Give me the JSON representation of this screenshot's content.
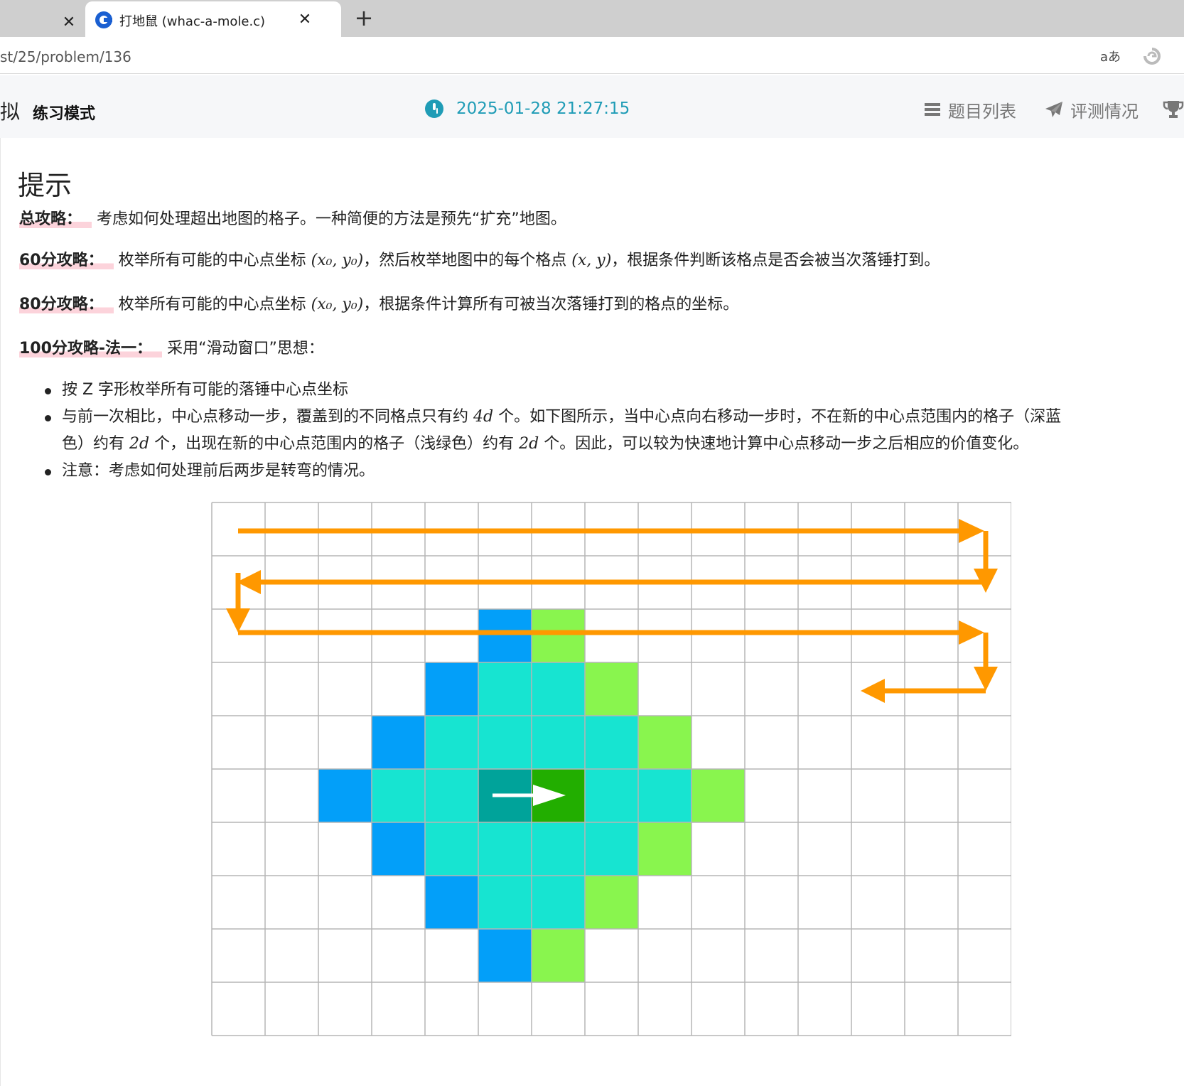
{
  "browser": {
    "active_tab_title": "打地鼠 (whac-a-mole.c)",
    "url": "st/25/problem/136",
    "read_aloud_label": "aあ"
  },
  "header": {
    "site_fragment": "拟",
    "mode": "练习模式",
    "time": "2025-01-28 21:27:15",
    "nav": {
      "problems": "题目列表",
      "status": "评测情况"
    }
  },
  "hint": {
    "title": "提示",
    "p1": {
      "label": "总攻略：",
      "text": "考虑如何处理超出地图的格子。一种简便的方法是预先“扩充”地图。"
    },
    "p2": {
      "label": "60分攻略：",
      "t1": "枚举所有可能的中心点坐标",
      "m1": "(x₀, y₀)",
      "t2": "，然后枚举地图中的每个格点",
      "m2": "(x, y)",
      "t3": "，根据条件判断该格点是否会被当次落锤打到。"
    },
    "p3": {
      "label": "80分攻略：",
      "t1": "枚举所有可能的中心点坐标",
      "m1": "(x₀, y₀)",
      "t2": "，根据条件计算所有可被当次落锤打到的格点的坐标。"
    },
    "p4": {
      "label": "100分攻略-法一：",
      "text": "采用“滑动窗口”思想："
    },
    "bullets": {
      "b1": "按 Z 字形枚举所有可能的落锤中心点坐标",
      "b2a": "与前一次相比，中心点移动一步，覆盖到的不同格点只有约",
      "b2m1": "4d",
      "b2b": "个。如下图所示，当中心点向右移动一步时，不在新的中心点范围内的格子（深蓝",
      "b2c": "色）约有",
      "b2m2": "2d",
      "b2d": "个，出现在新的中心点范围内的格子（浅绿色）约有",
      "b2m3": "2d",
      "b2e": "个。因此，可以较为快速地计算中心点移动一步之后相应的价值变化。",
      "b3": "注意：考虑如何处理前后两步是转弯的情况。"
    }
  },
  "figure": {
    "cols": 15,
    "rows": 10,
    "colors": {
      "dark_blue": "#039ff9",
      "cyan": "#17e4d1",
      "light_green": "#89f54e",
      "old_center": "#00a39a",
      "new_center": "#22ae00",
      "arrow": "#ff9800",
      "grid": "#b5b5b5"
    },
    "cells": [
      {
        "r": 2,
        "c": 5,
        "k": "dark_blue"
      },
      {
        "r": 2,
        "c": 6,
        "k": "light_green"
      },
      {
        "r": 3,
        "c": 4,
        "k": "dark_blue"
      },
      {
        "r": 3,
        "c": 5,
        "k": "cyan"
      },
      {
        "r": 3,
        "c": 6,
        "k": "cyan"
      },
      {
        "r": 3,
        "c": 7,
        "k": "light_green"
      },
      {
        "r": 4,
        "c": 3,
        "k": "dark_blue"
      },
      {
        "r": 4,
        "c": 4,
        "k": "cyan"
      },
      {
        "r": 4,
        "c": 5,
        "k": "cyan"
      },
      {
        "r": 4,
        "c": 6,
        "k": "cyan"
      },
      {
        "r": 4,
        "c": 7,
        "k": "cyan"
      },
      {
        "r": 4,
        "c": 8,
        "k": "light_green"
      },
      {
        "r": 5,
        "c": 2,
        "k": "dark_blue"
      },
      {
        "r": 5,
        "c": 3,
        "k": "cyan"
      },
      {
        "r": 5,
        "c": 4,
        "k": "cyan"
      },
      {
        "r": 5,
        "c": 5,
        "k": "old_center"
      },
      {
        "r": 5,
        "c": 6,
        "k": "new_center"
      },
      {
        "r": 5,
        "c": 7,
        "k": "cyan"
      },
      {
        "r": 5,
        "c": 8,
        "k": "cyan"
      },
      {
        "r": 5,
        "c": 9,
        "k": "light_green"
      },
      {
        "r": 6,
        "c": 3,
        "k": "dark_blue"
      },
      {
        "r": 6,
        "c": 4,
        "k": "cyan"
      },
      {
        "r": 6,
        "c": 5,
        "k": "cyan"
      },
      {
        "r": 6,
        "c": 6,
        "k": "cyan"
      },
      {
        "r": 6,
        "c": 7,
        "k": "cyan"
      },
      {
        "r": 6,
        "c": 8,
        "k": "light_green"
      },
      {
        "r": 7,
        "c": 4,
        "k": "dark_blue"
      },
      {
        "r": 7,
        "c": 5,
        "k": "cyan"
      },
      {
        "r": 7,
        "c": 6,
        "k": "cyan"
      },
      {
        "r": 7,
        "c": 7,
        "k": "light_green"
      },
      {
        "r": 8,
        "c": 5,
        "k": "dark_blue"
      },
      {
        "r": 8,
        "c": 6,
        "k": "light_green"
      }
    ]
  }
}
